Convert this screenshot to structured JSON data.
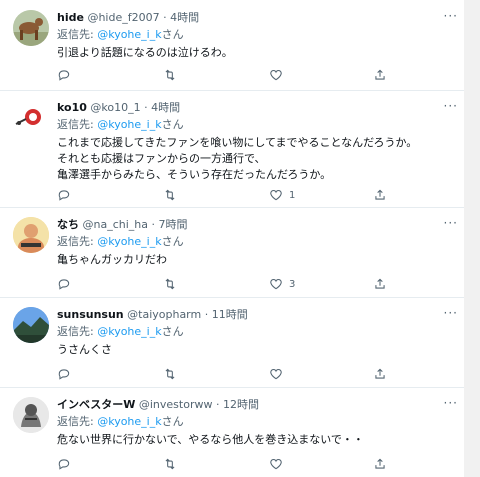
{
  "reply_prefix": "返信先:",
  "reply_suffix": "さん",
  "tweets": [
    {
      "name": "hide",
      "handle": "@hide_f2007",
      "time": "4時間",
      "reply_to": "@kyohe_i_k",
      "text": "引退より話題になるのは泣けるわ。",
      "reply_count": "",
      "like_count": ""
    },
    {
      "name": "ko10",
      "handle": "@ko10_1",
      "time": "4時間",
      "reply_to": "@kyohe_i_k",
      "text": "これまで応援してきたファンを喰い物にしてまでやることなんだろうか。\nそれとも応援はファンからの一方通行で、\n亀澤選手からみたら、そういう存在だったんだろうか。",
      "reply_count": "",
      "like_count": "1"
    },
    {
      "name": "なち",
      "handle": "@na_chi_ha",
      "time": "7時間",
      "reply_to": "@kyohe_i_k",
      "text": "亀ちゃんガッカリだわ",
      "reply_count": "",
      "like_count": "3"
    },
    {
      "name": "sunsunsun",
      "handle": "@taiyopharm",
      "time": "11時間",
      "reply_to": "@kyohe_i_k",
      "text": "うさんくさ",
      "reply_count": "",
      "like_count": ""
    },
    {
      "name": "インベスターW",
      "handle": "@investorww",
      "time": "12時間",
      "reply_to": "@kyohe_i_k",
      "text": "危ない世界に行かないで、やるなら他人を巻き込まないで・・",
      "reply_count": "",
      "like_count": ""
    }
  ],
  "icons": {
    "reply": "speech-bubble",
    "retweet": "retweet-arrows",
    "like": "heart",
    "share": "share-upload",
    "more": "ellipsis"
  }
}
